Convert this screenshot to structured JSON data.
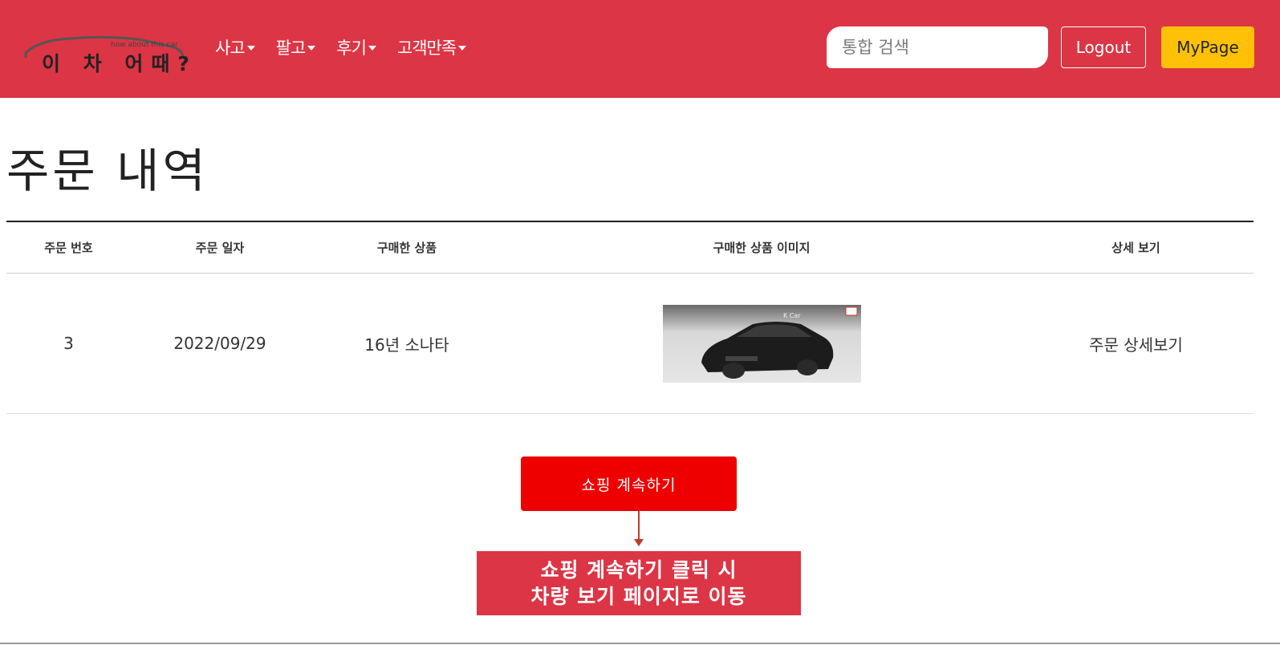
{
  "header": {
    "logo_text": "이 차 어때?",
    "logo_tagline": "how about this car",
    "nav": [
      {
        "label": "사고"
      },
      {
        "label": "팔고"
      },
      {
        "label": "후기"
      },
      {
        "label": "고객만족"
      }
    ],
    "search_placeholder": "통합 검색",
    "logout_label": "Logout",
    "mypage_label": "MyPage"
  },
  "main": {
    "title": "주문 내역",
    "table": {
      "headers": [
        "주문 번호",
        "주문 일자",
        "구매한 상품",
        "구매한 상품 이미지",
        "상세 보기"
      ],
      "rows": [
        {
          "order_no": "3",
          "date": "2022/09/29",
          "product": "16년 소나타",
          "image_icon": "car-photo",
          "detail": "주문 상세보기"
        }
      ]
    },
    "continue_button": "쇼핑 계속하기"
  },
  "annotation": {
    "line1": "쇼핑 계속하기 클릭 시",
    "line2": "차량 보기 페이지로 이동"
  },
  "colors": {
    "header_bg": "#dc3545",
    "mypage_bg": "#ffc107",
    "continue_bg": "#ee0000",
    "annotation_bg": "#dc3545"
  }
}
